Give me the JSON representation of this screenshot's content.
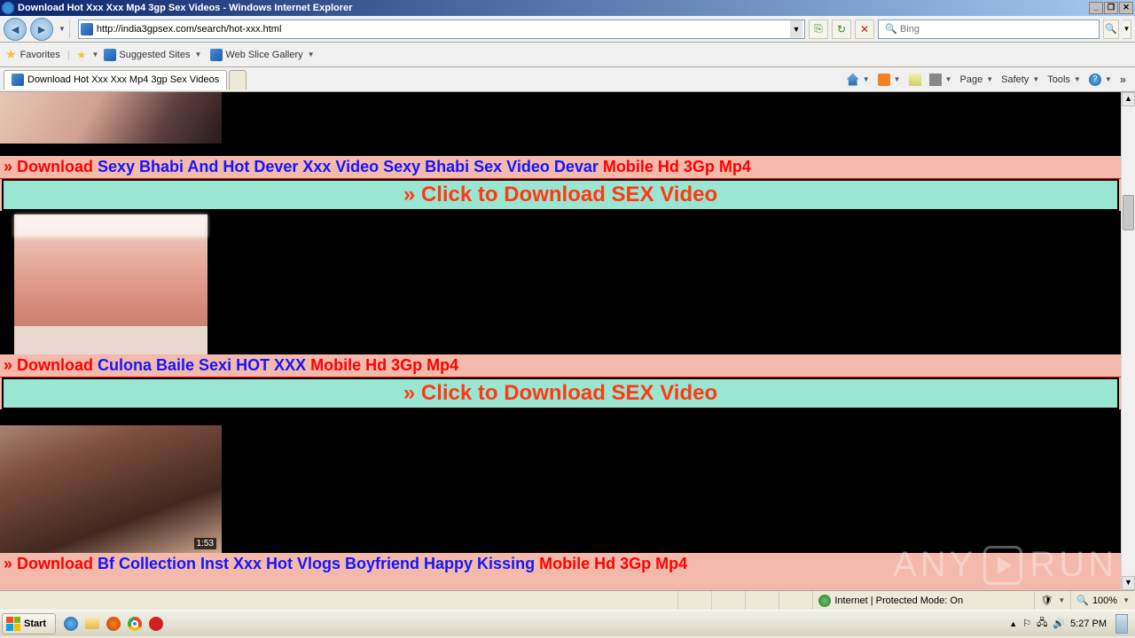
{
  "window": {
    "title": "Download Hot Xxx Xxx Mp4 3gp Sex Videos - Windows Internet Explorer"
  },
  "nav": {
    "url": "http://india3gpsex.com/search/hot-xxx.html",
    "search_placeholder": "Bing"
  },
  "favorites": {
    "label": "Favorites",
    "suggested": "Suggested Sites",
    "webslice": "Web Slice Gallery"
  },
  "tab": {
    "title": "Download Hot Xxx Xxx Mp4 3gp Sex Videos"
  },
  "cmdbar": {
    "page": "Page",
    "safety": "Safety",
    "tools": "Tools"
  },
  "items": [
    {
      "download": "» Download ",
      "title": "Sexy Bhabi And Hot Dever Xxx Video Sexy Bhabi Sex Video Devar ",
      "suffix": "Mobile Hd 3Gp Mp4"
    },
    {
      "download": "» Download ",
      "title": "Culona Baile Sexi HOT XXX ",
      "suffix": "Mobile Hd 3Gp Mp4"
    },
    {
      "download": "» Download ",
      "title": "Bf Collection Inst Xxx Hot Vlogs Boyfriend Happy Kissing ",
      "suffix": "Mobile Hd 3Gp Mp4"
    }
  ],
  "banner": "» Click to Download SEX Video",
  "thumb3_duration": "1:53",
  "status": {
    "zone": "Internet | Protected Mode: On",
    "zoom": "100%"
  },
  "taskbar": {
    "start": "Start",
    "time": "5:27 PM"
  },
  "watermark": {
    "a": "ANY",
    "b": "RUN"
  }
}
